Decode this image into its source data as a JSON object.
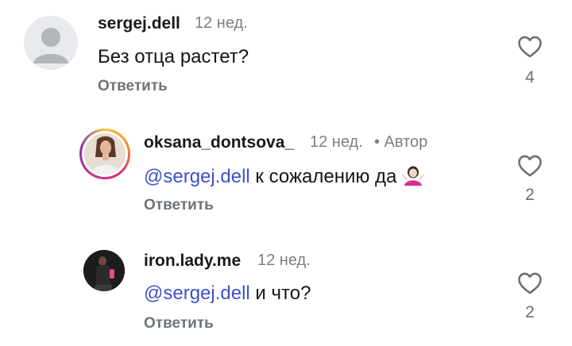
{
  "comments": [
    {
      "username": "sergej.dell",
      "time": "12 нед.",
      "author_badge": "",
      "mention": "",
      "text": "Без отца растет?",
      "reply_label": "Ответить",
      "likes": "4"
    },
    {
      "username": "oksana_dontsova_",
      "time": "12 нед.",
      "author_badge": "• Автор",
      "mention": "@sergej.dell",
      "text": " к сожалению да",
      "reply_label": "Ответить",
      "likes": "2"
    },
    {
      "username": "iron.lady.me",
      "time": "12 нед.",
      "author_badge": "",
      "mention": "@sergej.dell",
      "text": " и что?",
      "reply_label": "Ответить",
      "likes": "2"
    }
  ],
  "icons": {
    "like": "heart-outline-icon",
    "emoji": "woman-shrugging-emoji",
    "avatar_default": "default-avatar-icon"
  },
  "colors": {
    "mention": "#3f51c8",
    "secondary_text": "#7b7f86"
  }
}
